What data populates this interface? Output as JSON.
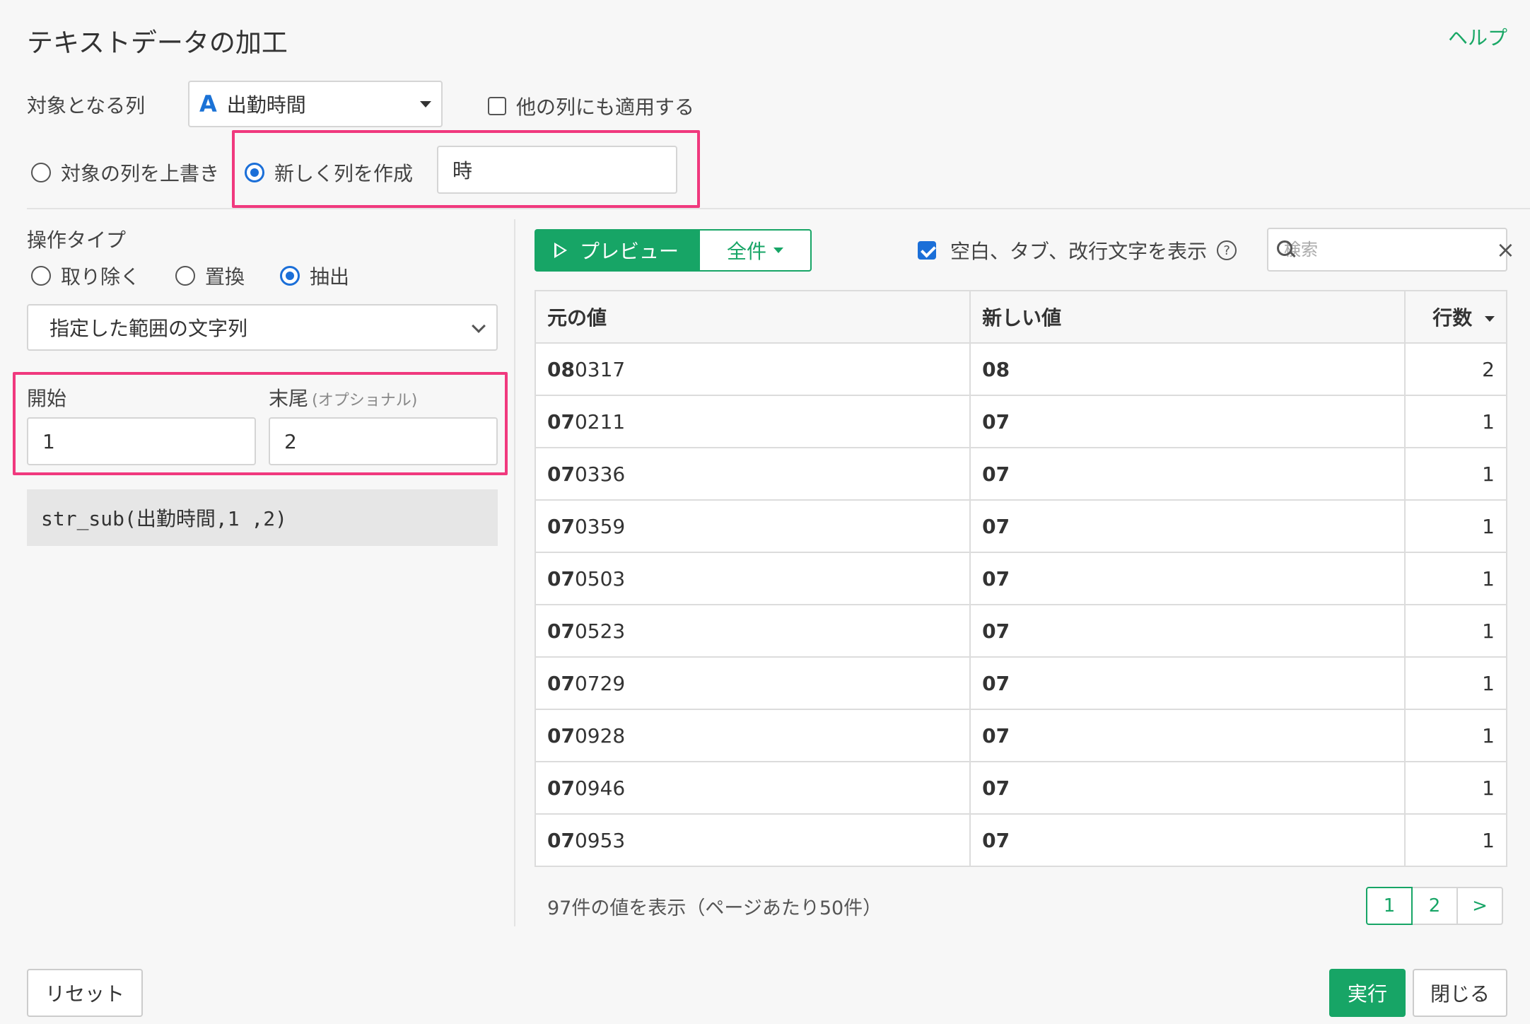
{
  "dialog": {
    "title": "テキストデータの加工",
    "help": "ヘルプ"
  },
  "target": {
    "label": "対象となる列",
    "column_type_icon": "A",
    "column": "出勤時間",
    "apply_other_label": "他の列にも適用する",
    "apply_other_checked": false
  },
  "output": {
    "overwrite_label": "対象の列を上書き",
    "create_label": "新しく列を作成",
    "selected": "create",
    "new_column_name": "時"
  },
  "operation": {
    "label": "操作タイプ",
    "options": [
      "取り除く",
      "置換",
      "抽出"
    ],
    "selected": "抽出",
    "method": "指定した範囲の文字列",
    "start_label": "開始",
    "end_label": "末尾",
    "end_hint": "(オプショナル)",
    "start_value": "1",
    "end_value": "2",
    "formula": "str_sub(出勤時間,1 ,2)"
  },
  "preview": {
    "preview_button": "プレビュー",
    "scope_button": "全件",
    "show_whitespace_label": "空白、タブ、改行文字を表示",
    "show_whitespace_checked": true,
    "help_icon": "?",
    "search_placeholder": "検索",
    "columns": [
      "元の値",
      "新しい値",
      "行数"
    ],
    "rows": [
      {
        "orig_bold": "08",
        "orig_rest": "0317",
        "new": "08",
        "count": "2"
      },
      {
        "orig_bold": "07",
        "orig_rest": "0211",
        "new": "07",
        "count": "1"
      },
      {
        "orig_bold": "07",
        "orig_rest": "0336",
        "new": "07",
        "count": "1"
      },
      {
        "orig_bold": "07",
        "orig_rest": "0359",
        "new": "07",
        "count": "1"
      },
      {
        "orig_bold": "07",
        "orig_rest": "0503",
        "new": "07",
        "count": "1"
      },
      {
        "orig_bold": "07",
        "orig_rest": "0523",
        "new": "07",
        "count": "1"
      },
      {
        "orig_bold": "07",
        "orig_rest": "0729",
        "new": "07",
        "count": "1"
      },
      {
        "orig_bold": "07",
        "orig_rest": "0928",
        "new": "07",
        "count": "1"
      },
      {
        "orig_bold": "07",
        "orig_rest": "0946",
        "new": "07",
        "count": "1"
      },
      {
        "orig_bold": "07",
        "orig_rest": "0953",
        "new": "07",
        "count": "1"
      }
    ],
    "summary": "97件の値を表示（ページあたり50件）",
    "pages": [
      "1",
      "2",
      ">"
    ],
    "current_page": "1"
  },
  "footer": {
    "reset": "リセット",
    "run": "実行",
    "close": "閉じる"
  },
  "colors": {
    "accent": "#17a566",
    "highlight": "#f0397e",
    "radio": "#1b6fd8"
  }
}
